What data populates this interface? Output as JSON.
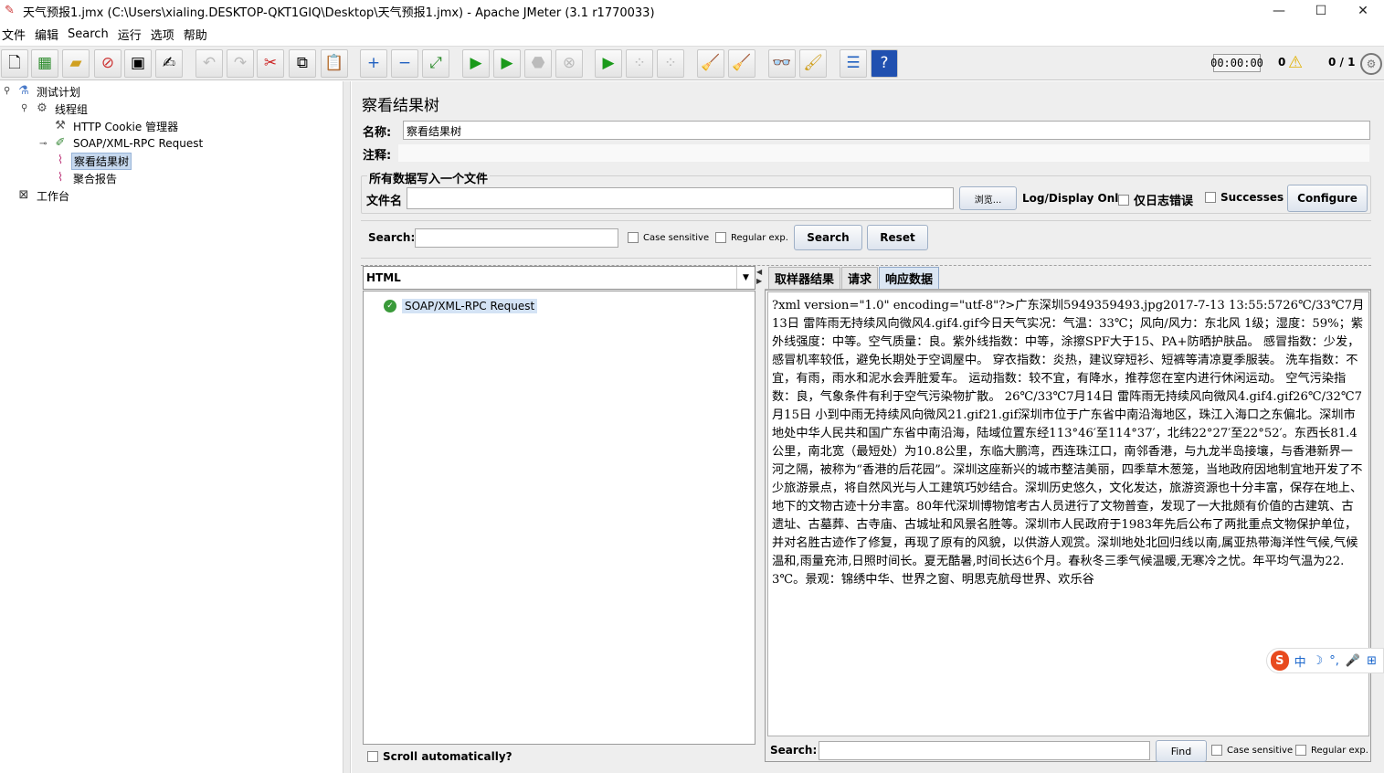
{
  "window": {
    "title": "天气预报1.jmx (C:\\Users\\xialing.DESKTOP-QKT1GIQ\\Desktop\\天气预报1.jmx) - Apache JMeter (3.1 r1770033)",
    "minimize": "—",
    "maximize": "☐",
    "close": "✕"
  },
  "menu": [
    "文件",
    "编辑",
    "Search",
    "运行",
    "选项",
    "帮助"
  ],
  "toolbar": {
    "timer": "00:00:00",
    "error_count": "0",
    "threads": "0 / 1"
  },
  "tree": {
    "test_plan": "测试计划",
    "thread_group": "线程组",
    "cookie_manager": "HTTP Cookie 管理器",
    "soap_request": "SOAP/XML-RPC Request",
    "view_results_tree": "察看结果树",
    "aggregate_report": "聚合报告",
    "workbench": "工作台"
  },
  "panel": {
    "title": "察看结果树",
    "name_label": "名称:",
    "name_value": "察看结果树",
    "comment_label": "注释:",
    "comment_value": "",
    "file_legend": "所有数据写入一个文件",
    "filename_label": "文件名",
    "filename_value": "",
    "browse_label": "浏览...",
    "log_display_label": "Log/Display Only:",
    "errors_only_label": "仅日志错误",
    "successes_label": "Successes",
    "configure_label": "Configure"
  },
  "search": {
    "label": "Search:",
    "value": "",
    "case_sensitive": "Case sensitive",
    "regular_exp": "Regular exp.",
    "search_button": "Search",
    "reset_button": "Reset"
  },
  "results": {
    "renderer": "HTML",
    "sample_label": "SOAP/XML-RPC Request",
    "scroll_auto": "Scroll automatically?"
  },
  "tabs": [
    "取样器结果",
    "请求",
    "响应数据"
  ],
  "response": {
    "text": "?xml version=\"1.0\" encoding=\"utf-8\"?>广东深圳5949359493.jpg2017-7-13 13:55:5726℃/33℃7月13日 雷阵雨无持续风向微风4.gif4.gif今日天气实况：气温：33℃；风向/风力：东北风 1级；湿度：59%；紫外线强度：中等。空气质量：良。紫外线指数：中等，涂擦SPF大于15、PA+防晒护肤品。 感冒指数：少发，感冒机率较低，避免长期处于空调屋中。 穿衣指数：炎热，建议穿短衫、短裤等清凉夏季服装。 洗车指数：不宜，有雨，雨水和泥水会弄脏爱车。 运动指数：较不宜，有降水，推荐您在室内进行休闲运动。 空气污染指数：良，气象条件有利于空气污染物扩散。 26℃/33℃7月14日 雷阵雨无持续风向微风4.gif4.gif26℃/32℃7月15日 小到中雨无持续风向微风21.gif21.gif深圳市位于广东省中南沿海地区，珠江入海口之东偏北。深圳市地处中华人民共和国广东省中南沿海，陆域位置东经113°46′至114°37′，北纬22°27′至22°52′。东西长81.4公里，南北宽（最短处）为10.8公里，东临大鹏湾，西连珠江口，南邻香港，与九龙半岛接壤，与香港新界一河之隔，被称为“香港的后花园”。深圳这座新兴的城市整洁美丽，四季草木葱笼，当地政府因地制宜地开发了不少旅游景点，将自然风光与人工建筑巧妙结合。深圳历史悠久，文化发达，旅游资源也十分丰富，保存在地上、地下的文物古迹十分丰富。80年代深圳博物馆考古人员进行了文物普查，发现了一大批颇有价值的古建筑、古遗址、古墓葬、古寺庙、古城址和风景名胜等。深圳市人民政府于1983年先后公布了两批重点文物保护单位，并对名胜古迹作了修复，再现了原有的风貌，以供游人观赏。深圳地处北回归线以南,属亚热带海洋性气候,气候温和,雨量充沛,日照时间长。夏无酷暑,时间长达6个月。春秋冬三季气候温暖,无寒冷之忧。年平均气温为22.3℃。景观：锦绣中华、世界之窗、明思克航母世界、欢乐谷",
    "search_label": "Search:",
    "search_value": "",
    "find_button": "Find",
    "case_sensitive": "Case sensitive",
    "regular_exp": "Regular exp."
  },
  "ime": {
    "logo": "S",
    "mode": "中",
    "moon": "☽",
    "punct": "°,",
    "mic": "🎤",
    "more": "⊞"
  }
}
